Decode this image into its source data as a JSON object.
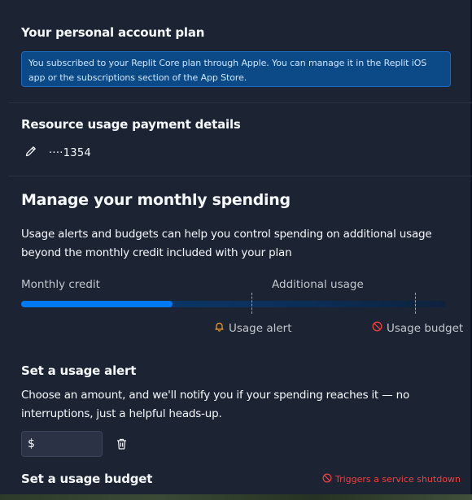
{
  "account_plan": {
    "heading": "Your personal account plan",
    "notice": "You subscribed to your Replit Core plan through Apple. You can manage it in the Replit iOS app or the subscriptions section of the App Store."
  },
  "payment": {
    "heading": "Resource usage payment details",
    "card_masked": "····1354"
  },
  "spending": {
    "heading": "Manage your monthly spending",
    "description": "Usage alerts and budgets can help you control spending on additional usage beyond the monthly credit included with your plan",
    "bar": {
      "monthly_credit_label": "Monthly credit",
      "additional_usage_label": "Additional usage",
      "usage_alert_label": "Usage alert",
      "usage_budget_label": "Usage budget"
    }
  },
  "usage_alert": {
    "heading": "Set a usage alert",
    "description": "Choose an amount, and we'll notify you if your spending reaches it — no interruptions, just a helpful heads-up.",
    "currency_symbol": "$",
    "value": ""
  },
  "usage_budget": {
    "heading": "Set a usage budget",
    "warning": "Triggers a service shutdown"
  },
  "colors": {
    "background": "#1c2333",
    "accent": "#0079f2",
    "alert_orange": "#f5a524",
    "danger_red": "#f23f3f"
  }
}
